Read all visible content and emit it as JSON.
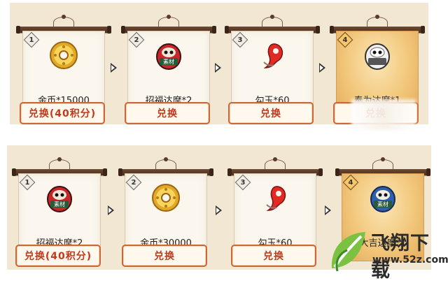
{
  "rows": [
    {
      "items": [
        {
          "rank": "1",
          "name": "金币*15000",
          "button": "兑换(40积分)",
          "icon": "gold-coin-icon",
          "highlight": false
        },
        {
          "rank": "2",
          "name": "招福达摩*2",
          "button": "兑换",
          "icon": "red-daruma-icon",
          "highlight": false
        },
        {
          "rank": "3",
          "name": "勾玉*60",
          "button": "兑换",
          "icon": "magatama-icon",
          "highlight": false
        },
        {
          "rank": "4",
          "name": "奉为达摩*1",
          "button": "兑换",
          "icon": "white-daruma-icon",
          "highlight": true
        }
      ]
    },
    {
      "items": [
        {
          "rank": "1",
          "name": "招福达摩*2",
          "button": "兑换(40积分)",
          "icon": "red-daruma-icon",
          "highlight": false
        },
        {
          "rank": "2",
          "name": "金币*30000",
          "button": "兑换",
          "icon": "gold-coin-icon",
          "highlight": false
        },
        {
          "rank": "3",
          "name": "勾玉*60",
          "button": "兑换",
          "icon": "magatama-icon",
          "highlight": false
        },
        {
          "rank": "4",
          "name": "大吉达摩*1",
          "button": "兑换",
          "icon": "blue-daruma-icon",
          "highlight": true
        }
      ]
    }
  ],
  "material_tag": "素材",
  "watermark": {
    "title": "飞翔下载",
    "url": "www.52z.com"
  },
  "colors": {
    "panel": "#f2e7d3",
    "button_border": "#c9693a",
    "button_text": "#c23a1c",
    "gold_paper": "#f2c77b"
  }
}
